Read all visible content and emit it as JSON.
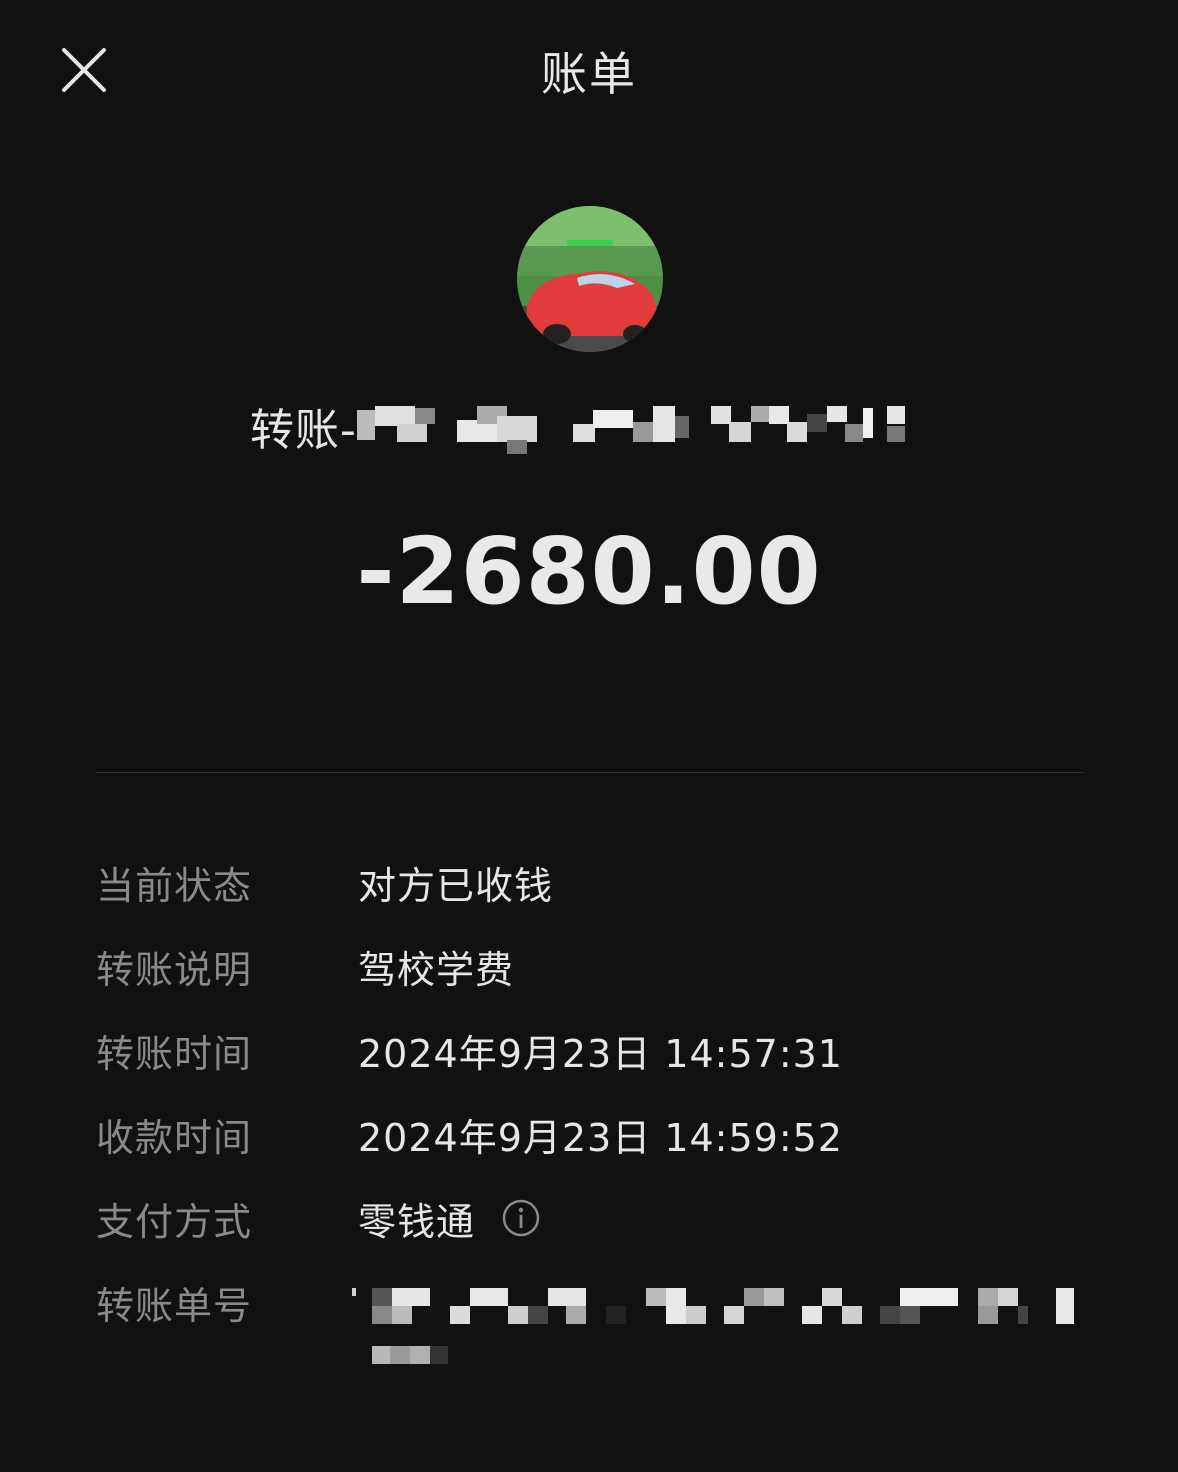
{
  "header": {
    "title": "账单",
    "close_icon": "close-icon"
  },
  "payee": {
    "label": "转账-"
  },
  "amount": "-2680.00",
  "details": [
    {
      "label": "当前状态",
      "value": "对方已收钱"
    },
    {
      "label": "转账说明",
      "value": "驾校学费"
    },
    {
      "label": "转账时间",
      "value": "2024年9月23日 14:57:31"
    },
    {
      "label": "收款时间",
      "value": "2024年9月23日 14:59:52"
    },
    {
      "label": "支付方式",
      "value": "零钱通",
      "icon": "info-icon"
    },
    {
      "label": "转账单号",
      "value": ""
    }
  ],
  "colors": {
    "background": "#111111",
    "primary_text": "#e6e6e6",
    "secondary_text": "#8a8a8a",
    "divider": "#2e2e2e"
  }
}
